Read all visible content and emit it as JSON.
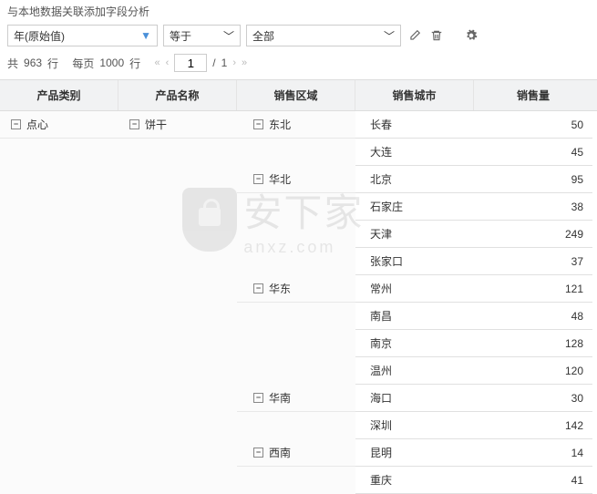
{
  "title": "与本地数据关联添加字段分析",
  "filter": {
    "field": "年(原始值)",
    "op": "等于",
    "value": "全部"
  },
  "pager": {
    "total_prefix": "共",
    "total": "963",
    "total_suffix": "行",
    "perpage_prefix": "每页",
    "perpage": "1000",
    "perpage_suffix": "行",
    "page": "1",
    "pages": "1"
  },
  "columns": {
    "c1": "产品类别",
    "c2": "产品名称",
    "c3": "销售区域",
    "c4": "销售城市",
    "c5": "销售量"
  },
  "data": {
    "category": "点心",
    "product": "饼干",
    "regions": [
      {
        "name": "东北",
        "cities": [
          {
            "name": "长春",
            "value": "50"
          },
          {
            "name": "大连",
            "value": "45"
          }
        ]
      },
      {
        "name": "华北",
        "cities": [
          {
            "name": "北京",
            "value": "95"
          },
          {
            "name": "石家庄",
            "value": "38"
          },
          {
            "name": "天津",
            "value": "249"
          },
          {
            "name": "张家口",
            "value": "37"
          }
        ]
      },
      {
        "name": "华东",
        "cities": [
          {
            "name": "常州",
            "value": "121"
          },
          {
            "name": "南昌",
            "value": "48"
          },
          {
            "name": "南京",
            "value": "128"
          },
          {
            "name": "温州",
            "value": "120"
          }
        ]
      },
      {
        "name": "华南",
        "cities": [
          {
            "name": "海口",
            "value": "30"
          },
          {
            "name": "深圳",
            "value": "142"
          }
        ]
      },
      {
        "name": "西南",
        "cities": [
          {
            "name": "昆明",
            "value": "14"
          },
          {
            "name": "重庆",
            "value": "41"
          }
        ]
      }
    ]
  },
  "watermark": {
    "big": "安下家",
    "small": "anxz.com"
  }
}
